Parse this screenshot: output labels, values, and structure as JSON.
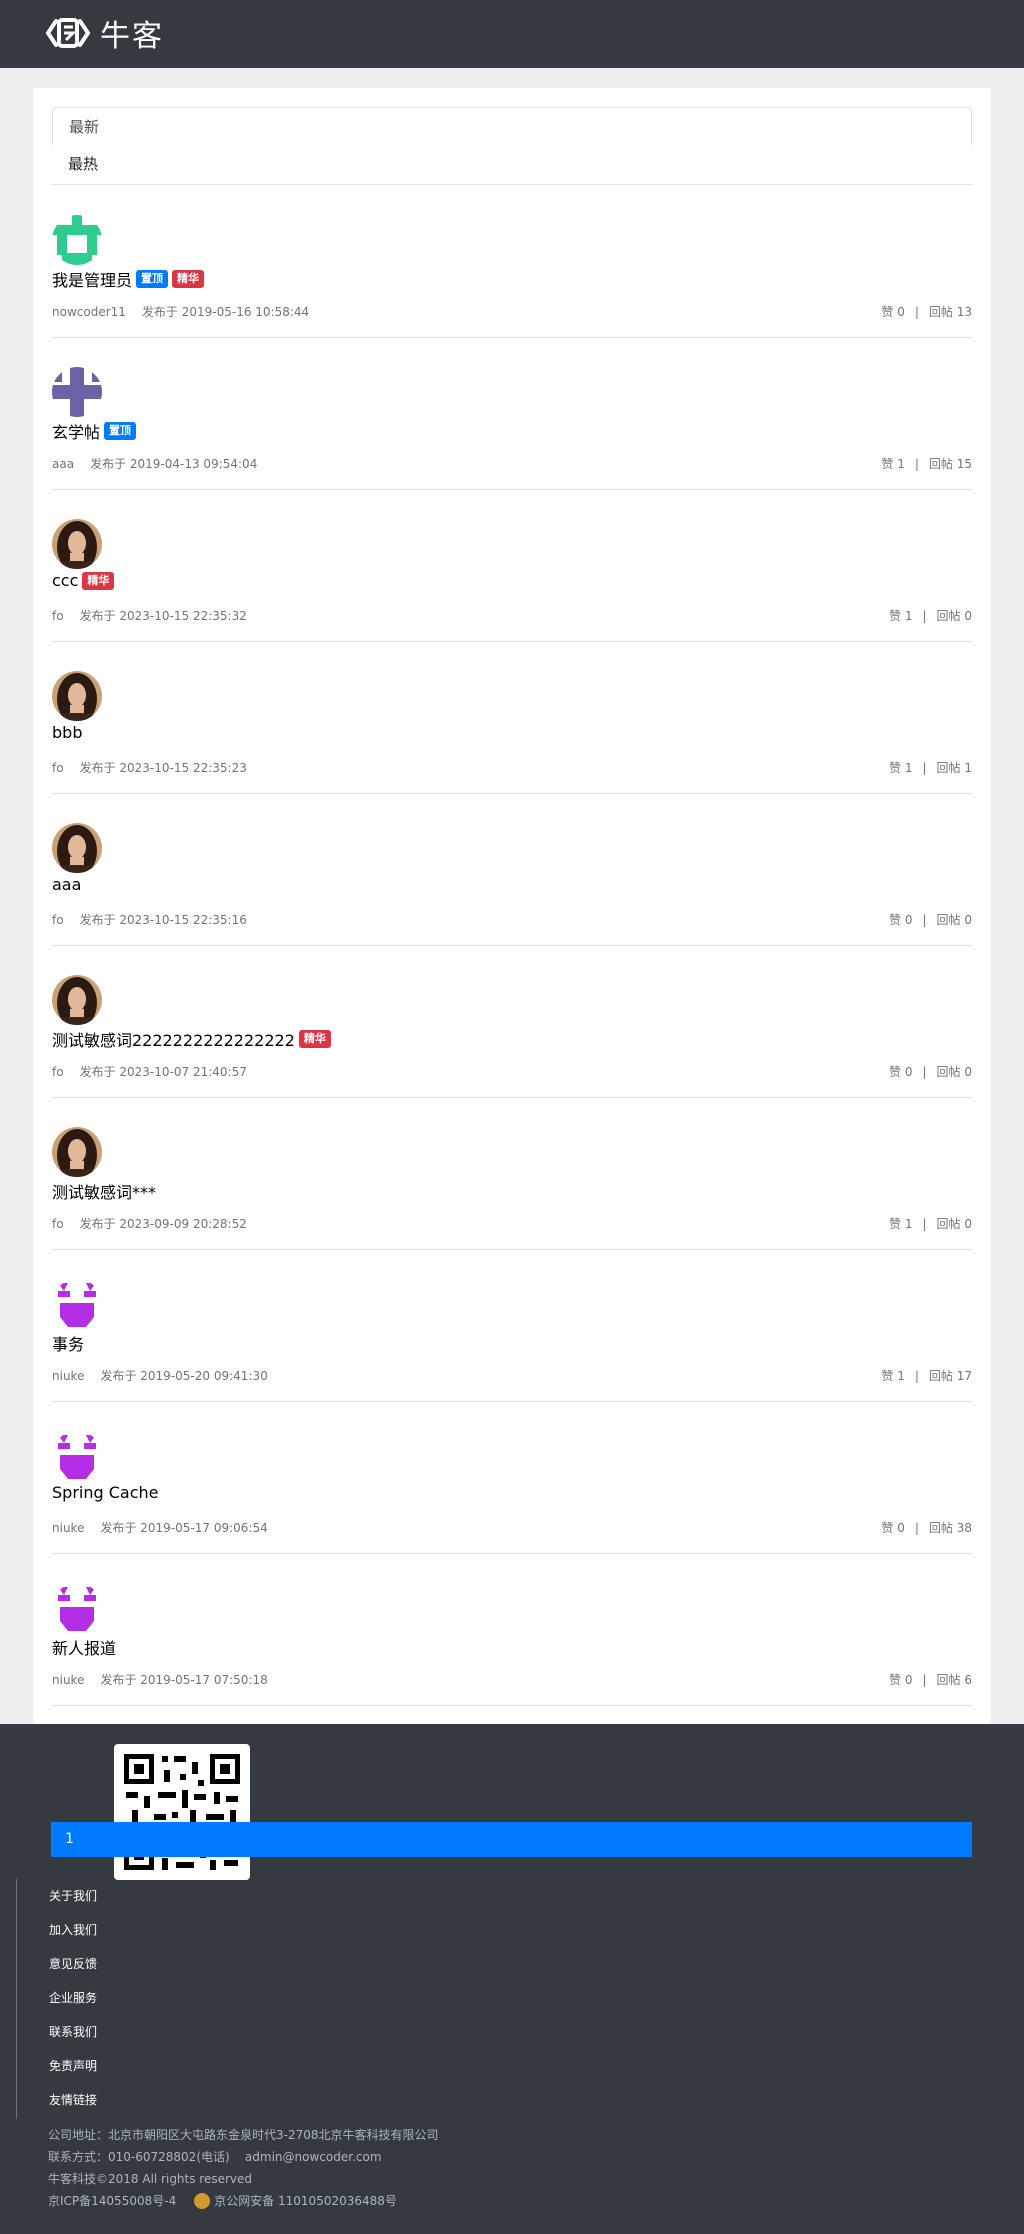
{
  "header": {
    "logo_text": "牛客"
  },
  "tabs": [
    {
      "label": "最新"
    },
    {
      "label": "最热"
    }
  ],
  "colors": {
    "accent": "#007bff",
    "elite": "#dc3545",
    "navbar": "#343a40"
  },
  "posts": [
    {
      "avatar": "green-robot-avatar",
      "title": "我是管理员",
      "badges": [
        "置顶",
        "精华"
      ],
      "author": "nowcoder11",
      "time": "发布于 2019-05-16 10:58:44",
      "likes": "赞 0",
      "replies": "回帖 13"
    },
    {
      "avatar": "purple-cross-avatar",
      "title": "玄学帖",
      "badges": [
        "置顶"
      ],
      "author": "aaa",
      "time": "发布于 2019-04-13 09:54:04",
      "likes": "赞 1",
      "replies": "回帖 15"
    },
    {
      "avatar": "photo-avatar",
      "title": "ccc",
      "badges": [
        "精华"
      ],
      "author": "fo",
      "time": "发布于 2023-10-15 22:35:32",
      "likes": "赞 1",
      "replies": "回帖 0"
    },
    {
      "avatar": "photo-avatar",
      "title": "bbb",
      "badges": [],
      "author": "fo",
      "time": "发布于 2023-10-15 22:35:23",
      "likes": "赞 1",
      "replies": "回帖 1"
    },
    {
      "avatar": "photo-avatar",
      "title": "aaa",
      "badges": [],
      "author": "fo",
      "time": "发布于 2023-10-15 22:35:16",
      "likes": "赞 0",
      "replies": "回帖 0"
    },
    {
      "avatar": "photo-avatar",
      "title": "测试敏感词2222222222222222",
      "badges": [
        "精华"
      ],
      "author": "fo",
      "time": "发布于 2023-10-07 21:40:57",
      "likes": "赞 0",
      "replies": "回帖 0"
    },
    {
      "avatar": "photo-avatar",
      "title": "测试敏感词***",
      "badges": [],
      "author": "fo",
      "time": "发布于 2023-09-09 20:28:52",
      "likes": "赞 1",
      "replies": "回帖 0"
    },
    {
      "avatar": "magenta-robot-avatar",
      "title": "事务",
      "badges": [],
      "author": "niuke",
      "time": "发布于 2019-05-20 09:41:30",
      "likes": "赞 1",
      "replies": "回帖 17"
    },
    {
      "avatar": "magenta-robot-avatar",
      "title": "Spring Cache",
      "badges": [],
      "author": "niuke",
      "time": "发布于 2019-05-17 09:06:54",
      "likes": "赞 0",
      "replies": "回帖 38"
    },
    {
      "avatar": "magenta-robot-avatar",
      "title": "新人报道",
      "badges": [],
      "author": "niuke",
      "time": "发布于 2019-05-17 07:50:18",
      "likes": "赞 0",
      "replies": "回帖 6"
    }
  ],
  "pagination": {
    "current": "1"
  },
  "footer": {
    "links": [
      "关于我们",
      "加入我们",
      "意见反馈",
      "企业服务",
      "联系我们",
      "免责声明",
      "友情链接"
    ],
    "address": "公司地址：北京市朝阳区大屯路东金泉时代3-2708北京牛客科技有限公司",
    "contact": "联系方式：010-60728802(电话)    admin@nowcoder.com",
    "copyright": "牛客科技©2018 All rights reserved",
    "icp": "京ICP备14055008号-4",
    "police": "京公网安备 11010502036488号"
  }
}
